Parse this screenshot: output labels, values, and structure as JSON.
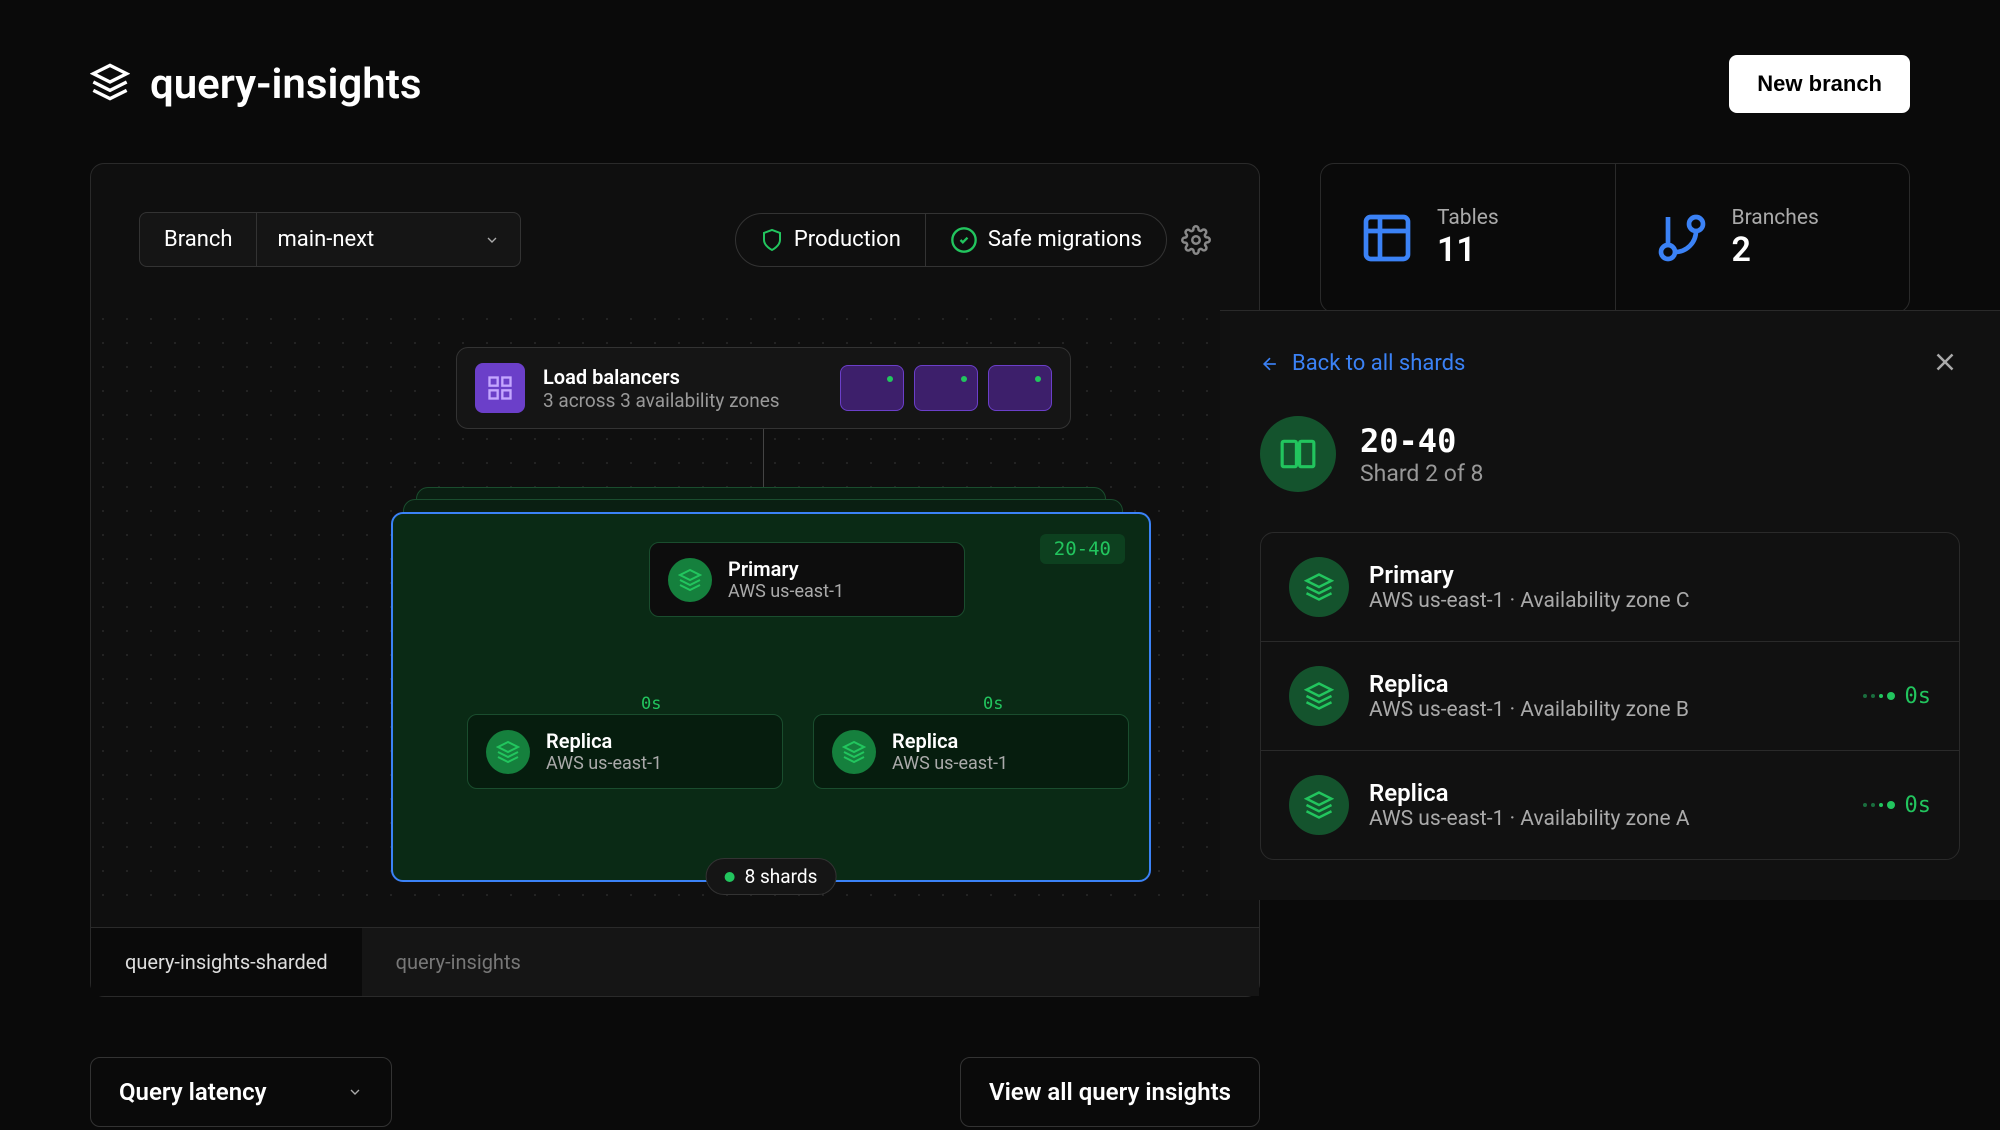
{
  "header": {
    "title": "query-insights",
    "new_branch_label": "New branch"
  },
  "toolbar": {
    "branch_label": "Branch",
    "branch_value": "main-next",
    "production_label": "Production",
    "safe_migrations_label": "Safe migrations"
  },
  "load_balancer": {
    "title": "Load balancers",
    "subtitle": "3 across 3 availability zones"
  },
  "shard_diagram": {
    "tag": "20-40",
    "primary": {
      "title": "Primary",
      "region": "AWS us-east-1"
    },
    "replica1": {
      "title": "Replica",
      "region": "AWS us-east-1",
      "latency": "0s"
    },
    "replica2": {
      "title": "Replica",
      "region": "AWS us-east-1",
      "latency": "0s"
    },
    "count_label": "8 shards"
  },
  "tabs": {
    "active": "query-insights-sharded",
    "inactive": "query-insights"
  },
  "bottom": {
    "query_latency": "Query latency",
    "view_all": "View all query insights"
  },
  "stats": {
    "tables": {
      "label": "Tables",
      "value": "11"
    },
    "branches": {
      "label": "Branches",
      "value": "2"
    }
  },
  "detail": {
    "back_label": "Back to all shards",
    "shard_name": "20-40",
    "shard_sub": "Shard 2 of 8",
    "nodes": [
      {
        "title": "Primary",
        "sub": "AWS us-east-1 · Availability zone C",
        "latency": ""
      },
      {
        "title": "Replica",
        "sub": "AWS us-east-1 · Availability zone B",
        "latency": "0s"
      },
      {
        "title": "Replica",
        "sub": "AWS us-east-1 · Availability zone A",
        "latency": "0s"
      }
    ]
  }
}
